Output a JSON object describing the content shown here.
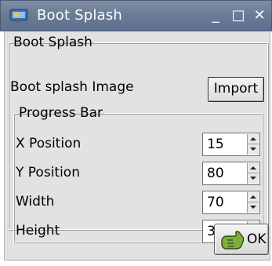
{
  "window": {
    "title": "Boot Splash",
    "minimize_glyph": "_",
    "maximize_glyph": "□",
    "close_glyph": "✕",
    "icon": "monitor-app-icon"
  },
  "boot_splash_group": {
    "title": "Boot Splash",
    "image_label": "Boot splash Image",
    "import_button": "Import"
  },
  "progress_bar_group": {
    "title": "Progress Bar",
    "fields": [
      {
        "label": "X Position",
        "value": "15"
      },
      {
        "label": "Y Position",
        "value": "80"
      },
      {
        "label": "Width",
        "value": "70"
      },
      {
        "label": "Height",
        "value": "3"
      }
    ]
  },
  "footer": {
    "ok_label": "OK",
    "ok_icon": "hand-pointer-icon"
  },
  "colors": {
    "titlebar": "#6b7c95",
    "dialog_bg": "#e2e2e2"
  }
}
